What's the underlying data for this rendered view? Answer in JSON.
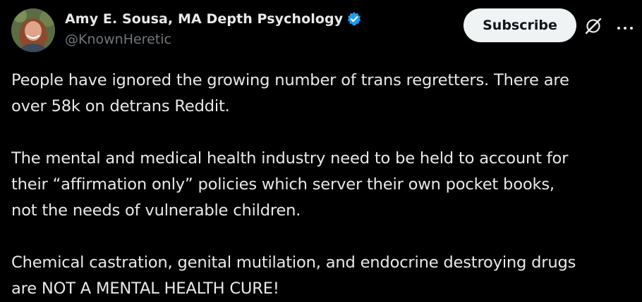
{
  "author": {
    "display_name": "Amy E. Sousa, MA Depth Psychology",
    "handle": "@KnownHeretic",
    "verified": true,
    "avatar_icon": "profile-photo"
  },
  "actions": {
    "subscribe_label": "Subscribe",
    "grok_icon": "grok-icon",
    "more_icon": "more-horizontal-icon"
  },
  "tweet": {
    "paragraphs": [
      [
        "People have ignored the growing number of trans regretters. There are",
        "over 58k on detrans Reddit."
      ],
      [
        "The mental and medical health industry need to be held to account for",
        "their “affirmation only” policies which server their own pocket books,",
        "not the needs of vulnerable children."
      ],
      [
        "Chemical castration, genital mutilation, and endocrine destroying drugs",
        "are NOT A MENTAL HEALTH CURE!"
      ]
    ]
  },
  "colors": {
    "background": "#000000",
    "text_primary": "#e7e9ea",
    "text_secondary": "#71767b",
    "verified_badge": "#1d9bf0",
    "subscribe_bg": "#eff3f4"
  }
}
